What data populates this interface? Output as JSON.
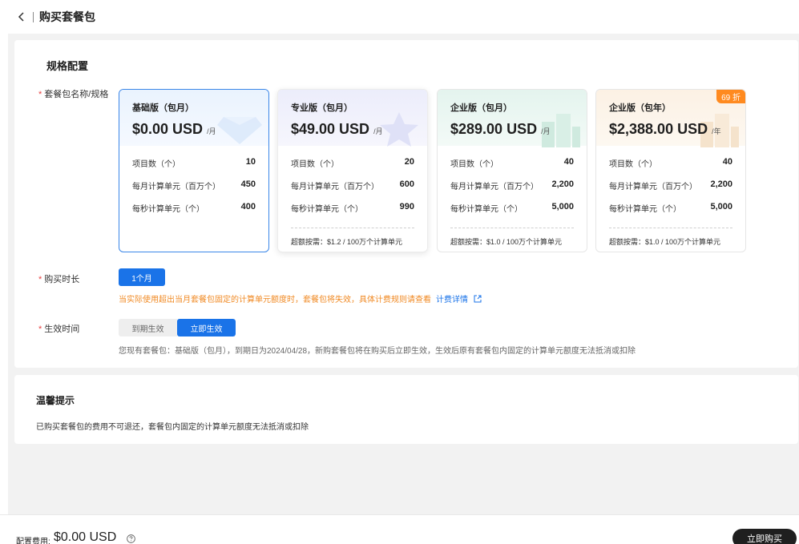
{
  "header": {
    "title": "购买套餐包"
  },
  "spec_section": {
    "title": "规格配置",
    "package_label": "套餐包名称/规格",
    "packages": [
      {
        "name": "基础版（包月）",
        "price": "$0.00 USD",
        "unit": "/月",
        "rows": [
          {
            "label": "项目数（个）",
            "value": "10"
          },
          {
            "label": "每月计算单元（百万个）",
            "value": "450"
          },
          {
            "label": "每秒计算单元（个）",
            "value": "400"
          }
        ],
        "overage": "",
        "selected": true
      },
      {
        "name": "专业版（包月）",
        "price": "$49.00 USD",
        "unit": "/月",
        "rows": [
          {
            "label": "项目数（个）",
            "value": "20"
          },
          {
            "label": "每月计算单元（百万个）",
            "value": "600"
          },
          {
            "label": "每秒计算单元（个）",
            "value": "990"
          }
        ],
        "overage": "超额按需：$1.2 / 100万个计算单元"
      },
      {
        "name": "企业版（包月）",
        "price": "$289.00 USD",
        "unit": "/月",
        "rows": [
          {
            "label": "项目数（个）",
            "value": "40"
          },
          {
            "label": "每月计算单元（百万个）",
            "value": "2,200"
          },
          {
            "label": "每秒计算单元（个）",
            "value": "5,000"
          }
        ],
        "overage": "超额按需：$1.0 / 100万个计算单元"
      },
      {
        "name": "企业版（包年）",
        "price": "$2,388.00 USD",
        "unit": "/年",
        "badge": "69 折",
        "rows": [
          {
            "label": "项目数（个）",
            "value": "40"
          },
          {
            "label": "每月计算单元（百万个）",
            "value": "2,200"
          },
          {
            "label": "每秒计算单元（个）",
            "value": "5,000"
          }
        ],
        "overage": "超额按需：$1.0 / 100万个计算单元"
      }
    ],
    "duration_label": "购买时长",
    "duration_option": "1个月",
    "duration_hint": "当实际使用超出当月套餐包固定的计算单元额度时，套餐包将失效，具体计费规则请查看",
    "duration_link": "计费详情",
    "effective_label": "生效时间",
    "effective_options": [
      "到期生效",
      "立即生效"
    ],
    "effective_hint": "您现有套餐包：基础版（包月），到期日为2024/04/28，新购套餐包将在购买后立即生效，生效后原有套餐包内固定的计算单元额度无法抵消或扣除"
  },
  "tips": {
    "title": "温馨提示",
    "text": "已购买套餐包的费用不可退还，套餐包内固定的计算单元额度无法抵消或扣除"
  },
  "footer": {
    "fee_label": "配置费用:",
    "fee_value": "$0.00 USD",
    "buy_label": "立即购买"
  },
  "colors": {
    "primary": "#1a73e8",
    "warning": "#f08a24",
    "required": "#e84040",
    "badge": "#ff8a1f"
  }
}
